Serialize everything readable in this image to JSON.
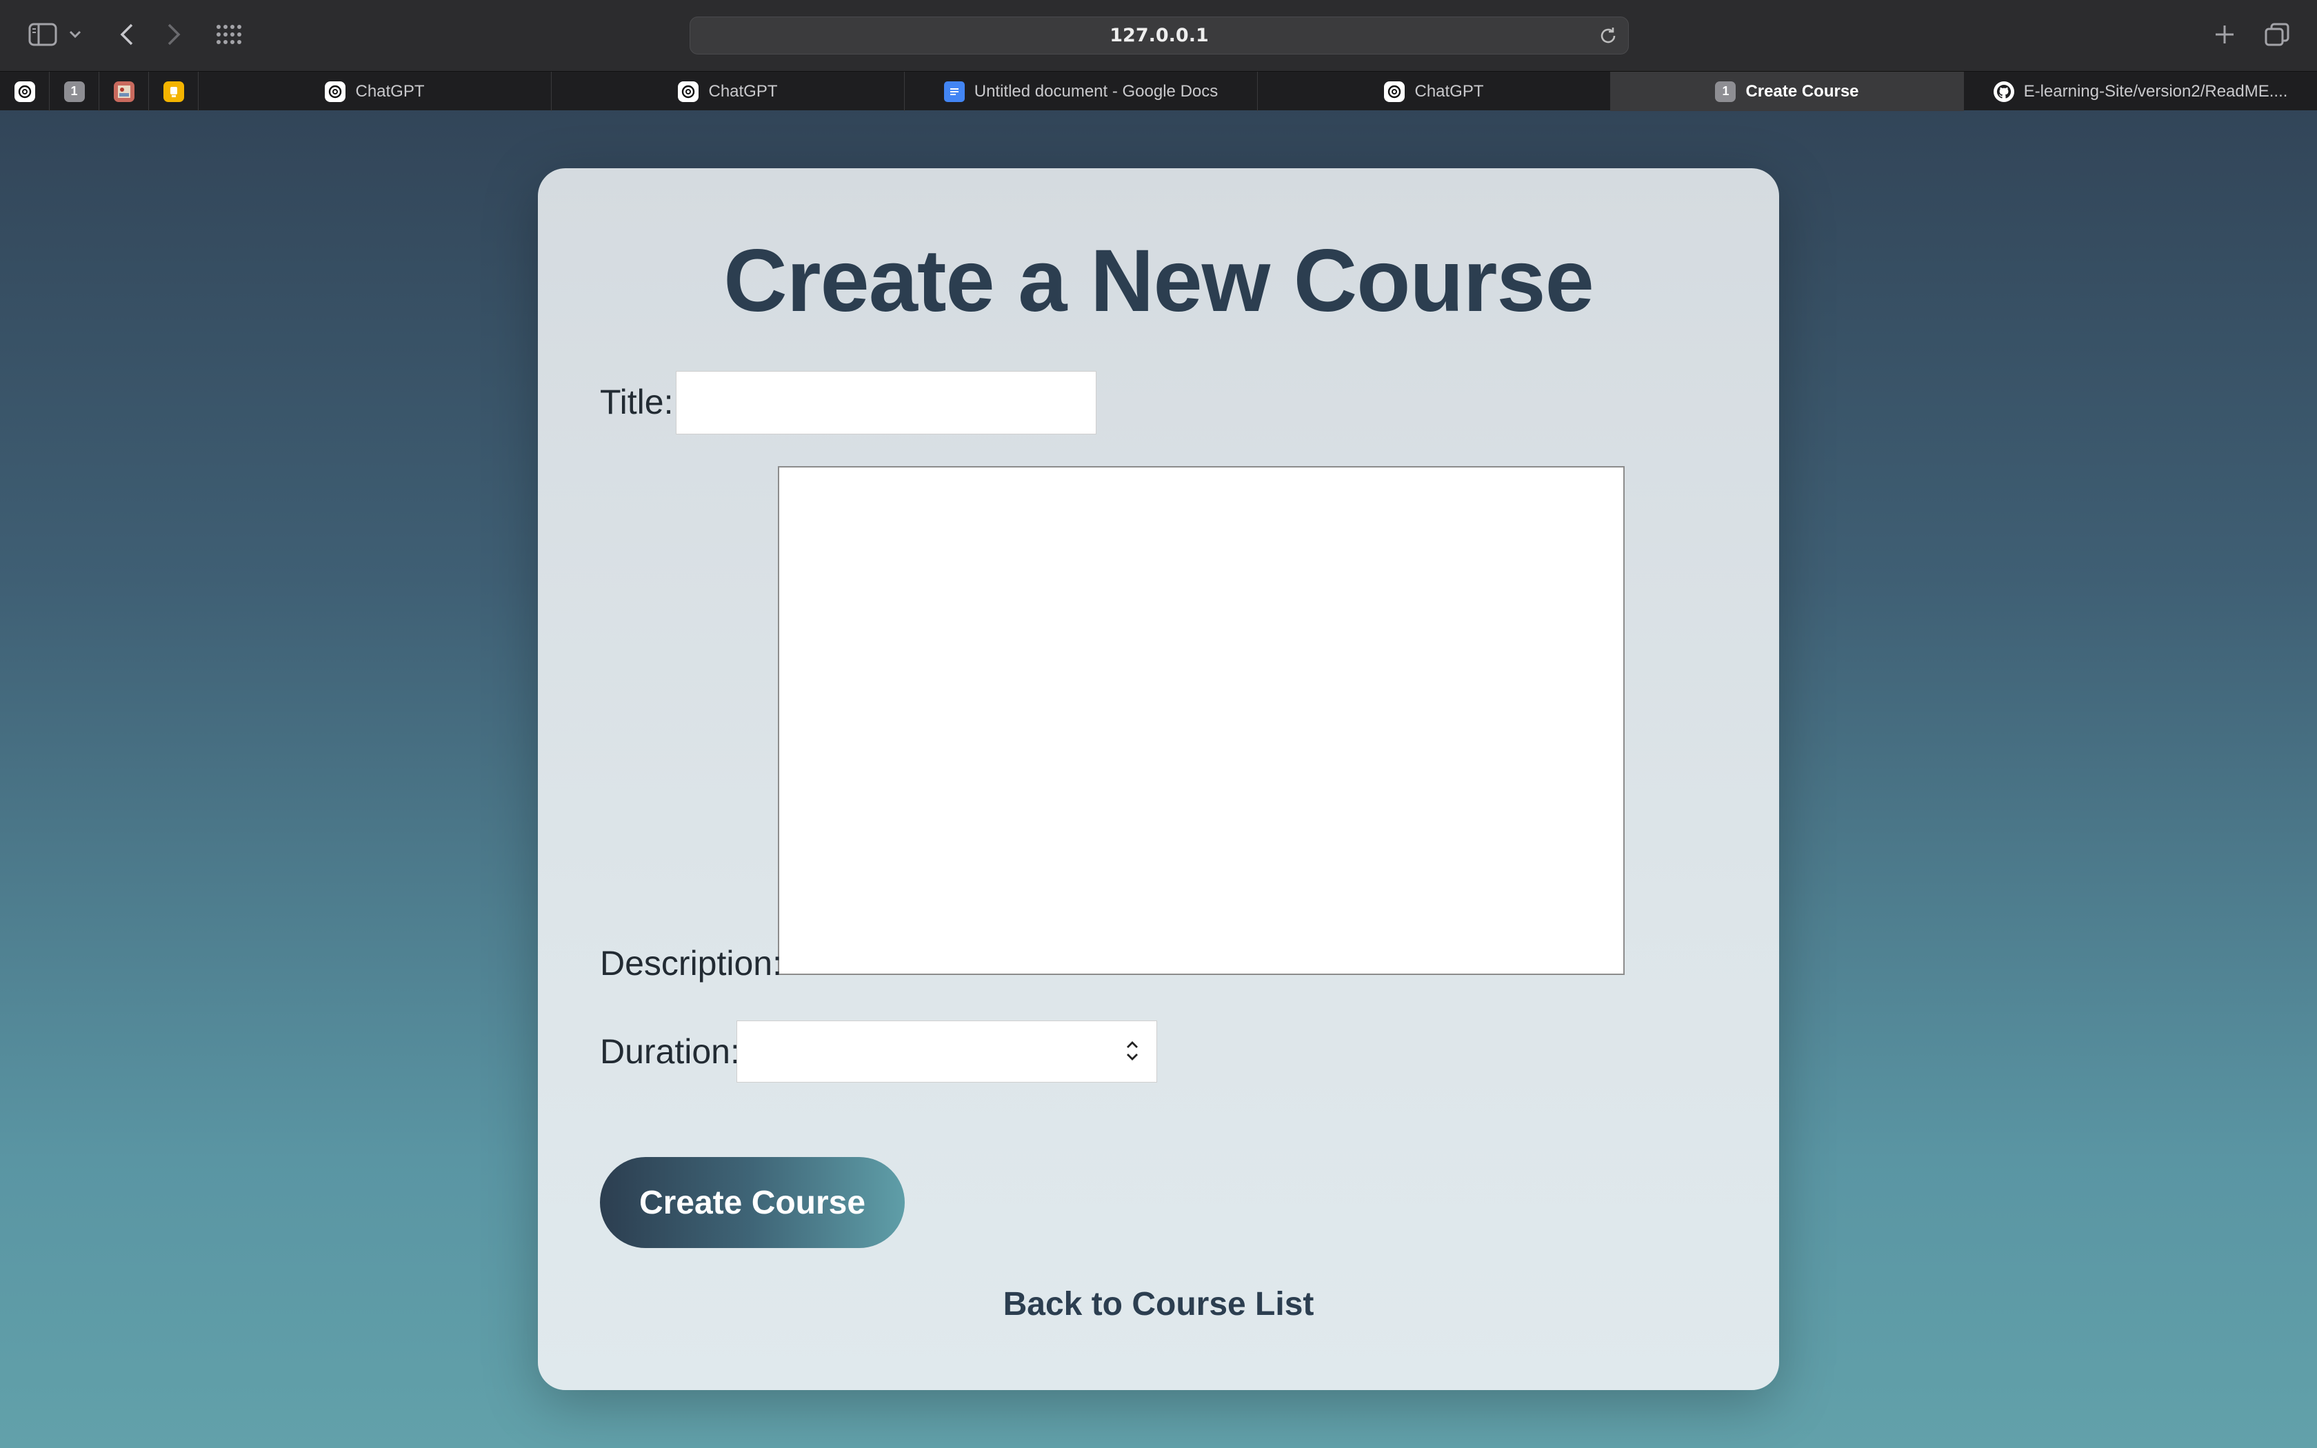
{
  "browser": {
    "url": "127.0.0.1",
    "pinned_tabs": [
      {
        "icon": "chatgpt-icon",
        "badge": ""
      },
      {
        "icon": "number-badge-icon",
        "badge": "1"
      },
      {
        "icon": "image-favicon-icon",
        "badge": ""
      },
      {
        "icon": "notes-favicon-icon",
        "badge": ""
      }
    ],
    "tabs": [
      {
        "label": "ChatGPT",
        "icon": "chatgpt-icon",
        "active": false
      },
      {
        "label": "ChatGPT",
        "icon": "chatgpt-icon",
        "active": false
      },
      {
        "label": "Untitled document - Google Docs",
        "icon": "google-docs-icon",
        "active": false
      },
      {
        "label": "ChatGPT",
        "icon": "chatgpt-icon",
        "active": false
      },
      {
        "label": "Create Course",
        "icon": "number-badge-icon",
        "badge": "1",
        "active": true
      },
      {
        "label": "E-learning-Site/version2/ReadME....",
        "icon": "github-icon",
        "active": false
      }
    ]
  },
  "form": {
    "heading": "Create a New Course",
    "title_label": "Title:",
    "title_value": "",
    "description_label": "Description:",
    "description_value": "",
    "duration_label": "Duration:",
    "duration_value": "",
    "submit_label": "Create Course",
    "back_link": "Back to Course List"
  },
  "colors": {
    "heading": "#2c3e50",
    "button_gradient_start": "#2c3e50",
    "button_gradient_end": "#5f9ea8",
    "background_top": "#2f3f52",
    "background_bottom": "#62a1aa"
  }
}
